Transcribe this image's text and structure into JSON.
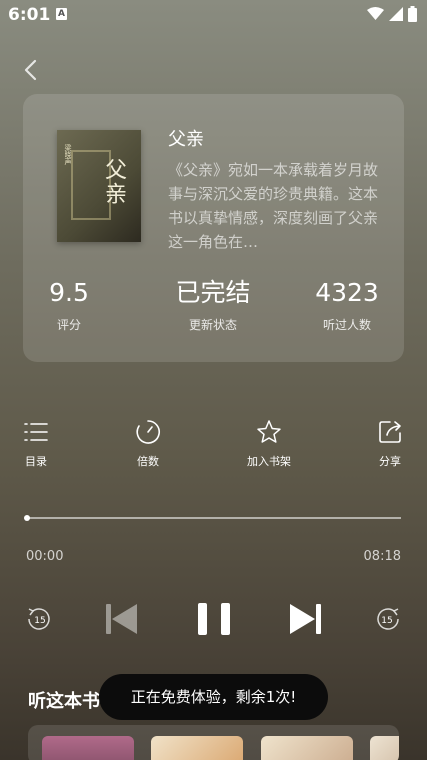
{
  "status_bar": {
    "time": "6:01",
    "notification_icon": "A"
  },
  "book": {
    "title": "父亲",
    "description": "《父亲》宛如一本承载着岁月故事与深沉父爱的珍贵典籍。这本书以真挚情感，深度刻画了父亲这一角色在…",
    "cover_title": "父亲",
    "cover_subtitle": "梁晓声"
  },
  "stats": [
    {
      "value": "9.5",
      "label": "评分"
    },
    {
      "value": "已完结",
      "label": "更新状态"
    },
    {
      "value": "4323",
      "label": "听过人数"
    }
  ],
  "actions": [
    {
      "icon": "list-icon",
      "label": "目录"
    },
    {
      "icon": "speed-icon",
      "label": "倍数"
    },
    {
      "icon": "star-icon",
      "label": "加入书架"
    },
    {
      "icon": "share-icon",
      "label": "分享"
    }
  ],
  "player": {
    "current_time": "00:00",
    "total_time": "08:18",
    "progress": 0.0,
    "rewind_seconds": "15",
    "forward_seconds": "15"
  },
  "section": {
    "title": "听这本书"
  },
  "toast": {
    "text": "正在免费体验，剩余1次!"
  },
  "colors": {
    "background_top": "#8a8c80",
    "background_bottom": "#3a342b",
    "toast_bg": "#0c0c0c"
  }
}
